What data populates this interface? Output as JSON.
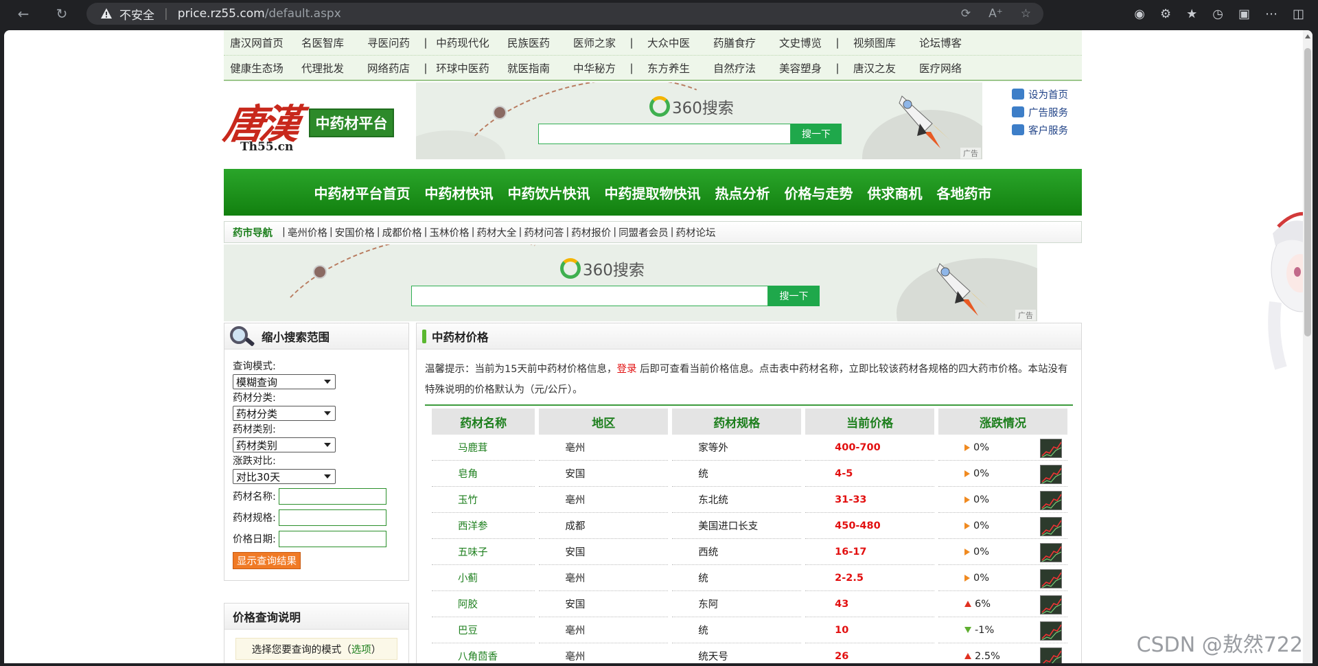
{
  "browser": {
    "security_label": "不安全",
    "url_host": "price.rz55.com",
    "url_path": "/default.aspx"
  },
  "toplinks": {
    "row1": [
      [
        "唐汉网首页",
        "名医智库",
        "寻医问药"
      ],
      [
        "中药现代化",
        "民族医药",
        "医师之家"
      ],
      [
        "大众中医",
        "药膳食疗",
        "文史博览"
      ],
      [
        "视频图库",
        "论坛博客"
      ]
    ],
    "row2": [
      [
        "健康生态场",
        "代理批发",
        "网络药店"
      ],
      [
        "环球中医药",
        "就医指南",
        "中华秘方"
      ],
      [
        "东方养生",
        "自然疗法",
        "美容塑身"
      ],
      [
        "唐汉之友",
        "医疗网络"
      ]
    ]
  },
  "logo": {
    "calligraphy": "唐漢",
    "platform": "中药材平台",
    "domain": "Th55.cn"
  },
  "ad": {
    "brand": "360搜索",
    "button": "搜一下",
    "tag": "广告"
  },
  "side_links": [
    "设为首页",
    "广告服务",
    "客户服务"
  ],
  "mainnav": [
    "中药材平台首页",
    "中药材快讯",
    "中药饮片快讯",
    "中药提取物快讯",
    "热点分析",
    "价格与走势",
    "供求商机",
    "各地药市"
  ],
  "subnav": {
    "lead": "药市导航",
    "items": [
      "亳州价格",
      "安国价格",
      "成都价格",
      "玉林价格",
      "药材大全",
      "药材问答",
      "药材报价",
      "同盟者会员",
      "药材论坛"
    ]
  },
  "search_panel": {
    "title": "缩小搜索范围",
    "mode_label": "查询模式:",
    "mode_value": "模糊查询",
    "category_label": "药材分类:",
    "category_value": "药材分类",
    "type_label": "药材类别:",
    "type_value": "药材类别",
    "compare_label": "涨跌对比:",
    "compare_value": "对比30天",
    "name_label": "药材名称:",
    "spec_label": "药材规格:",
    "date_label": "价格日期:",
    "submit": "显示查询结果"
  },
  "help_panel": {
    "title": "价格查询说明",
    "tip_prefix": "选择您要查询的模式（",
    "tip_link": "选项",
    "tip_suffix": "）"
  },
  "prices_panel": {
    "title": "中药材价格",
    "notice_a": "温馨提示：当前为15天前中药材价格信息，",
    "notice_login": "登录",
    "notice_b": " 后即可查看当前价格信息。点击表中药材名称，立即比较该药材各规格的四大药市价格。本站没有特殊说明的价格默认为（元/公斤）。",
    "headers": [
      "药材名称",
      "地区",
      "药材规格",
      "当前价格",
      "涨跌情况"
    ],
    "rows": [
      {
        "name": "马鹿茸",
        "region": "亳州",
        "spec": "家等外",
        "price": "400-700",
        "change": "0%",
        "dir": "flat"
      },
      {
        "name": "皂角",
        "region": "安国",
        "spec": "统",
        "price": "4-5",
        "change": "0%",
        "dir": "flat"
      },
      {
        "name": "玉竹",
        "region": "亳州",
        "spec": "东北统",
        "price": "31-33",
        "change": "0%",
        "dir": "flat"
      },
      {
        "name": "西洋参",
        "region": "成都",
        "spec": "美国进口长支",
        "price": "450-480",
        "change": "0%",
        "dir": "flat"
      },
      {
        "name": "五味子",
        "region": "安国",
        "spec": "西统",
        "price": "16-17",
        "change": "0%",
        "dir": "flat"
      },
      {
        "name": "小蓟",
        "region": "亳州",
        "spec": "统",
        "price": "2-2.5",
        "change": "0%",
        "dir": "flat"
      },
      {
        "name": "阿胶",
        "region": "安国",
        "spec": "东阿",
        "price": "43",
        "change": "6%",
        "dir": "up"
      },
      {
        "name": "巴豆",
        "region": "亳州",
        "spec": "统",
        "price": "10",
        "change": "-1%",
        "dir": "down"
      },
      {
        "name": "八角茴香",
        "region": "亳州",
        "spec": "统天号",
        "price": "26",
        "change": "2.5%",
        "dir": "up"
      }
    ]
  },
  "watermark": "CSDN @敖然722"
}
